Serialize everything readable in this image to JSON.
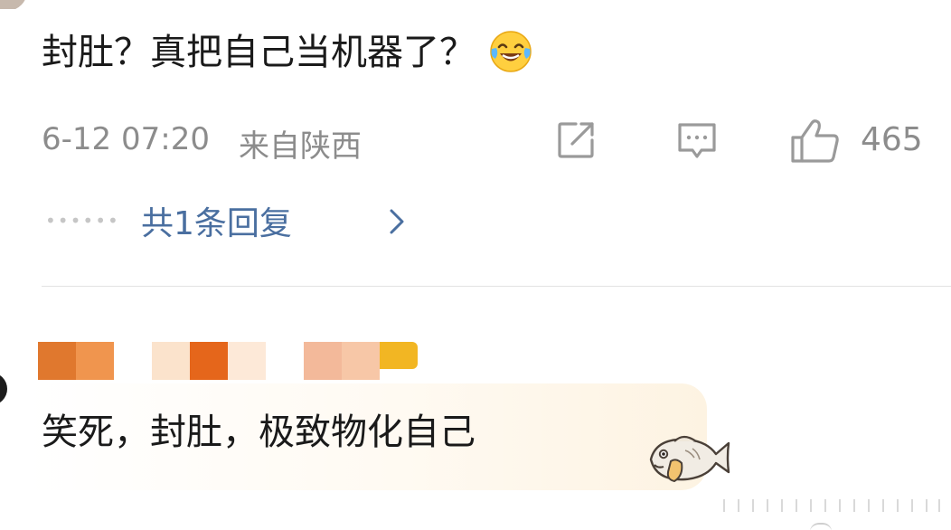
{
  "comment1": {
    "text": "封肚？真把自己当机器了？",
    "emoji": "laughing-tears-emoji",
    "time": "6-12 07:20",
    "location": "来自陕西",
    "like_count": "465",
    "reply_link": "共1条回复"
  },
  "comment2": {
    "text": "笑死，封肚，极致物化自己",
    "sticker": "fish-sticker"
  },
  "colors": {
    "text_primary": "#1a1a1a",
    "text_meta": "#8c8c8c",
    "link": "#4a6fa0",
    "divider": "#e3e3e3",
    "username_pixels": [
      "#e0782e",
      "#f0954e",
      "#fbe3cc",
      "#e5661b",
      "#fde9d8",
      "#f3b99a",
      "#f7c7a7",
      "#f2b623"
    ]
  }
}
